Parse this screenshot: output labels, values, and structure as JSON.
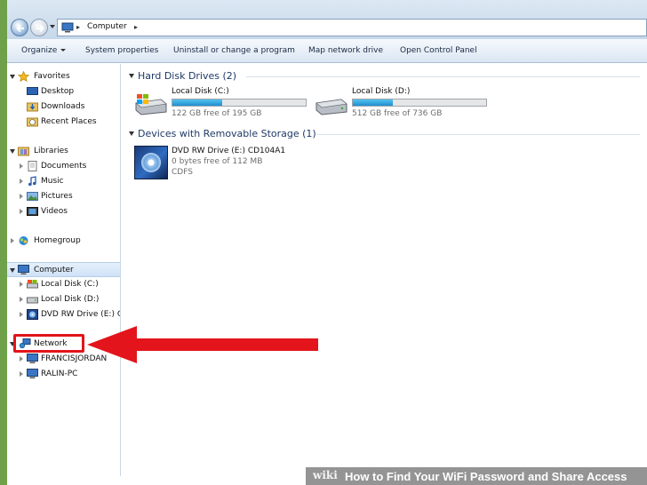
{
  "address_bar": {
    "path": [
      "Computer"
    ]
  },
  "toolbar": {
    "organize": "Organize",
    "system_properties": "System properties",
    "uninstall": "Uninstall or change a program",
    "map_drive": "Map network drive",
    "control_panel": "Open Control Panel"
  },
  "nav": {
    "favorites": {
      "label": "Favorites",
      "items": [
        "Desktop",
        "Downloads",
        "Recent Places"
      ]
    },
    "libraries": {
      "label": "Libraries",
      "items": [
        "Documents",
        "Music",
        "Pictures",
        "Videos"
      ]
    },
    "homegroup": {
      "label": "Homegroup"
    },
    "computer": {
      "label": "Computer",
      "items": [
        "Local Disk (C:)",
        "Local Disk (D:)",
        "DVD RW Drive (E:) C"
      ]
    },
    "network": {
      "label": "Network",
      "items": [
        "FRANCISJORDAN",
        "RALIN-PC"
      ]
    }
  },
  "content": {
    "hard_disk_group": {
      "title": "Hard Disk Drives (2)",
      "drives": [
        {
          "name": "Local Disk (C:)",
          "free_text": "122 GB free of 195 GB",
          "used_fraction": 0.37
        },
        {
          "name": "Local Disk (D:)",
          "free_text": "512 GB free of 736 GB",
          "used_fraction": 0.3
        }
      ]
    },
    "removable_group": {
      "title": "Devices with Removable Storage (1)",
      "device": {
        "name": "DVD RW Drive (E:) CD104A1",
        "free_text": "0 bytes free of 112 MB",
        "filesystem": "CDFS"
      }
    }
  },
  "annotation": {
    "color": "#e3141b"
  },
  "footer": {
    "brand": "wiki",
    "title": "How to Find Your WiFi Password and Share Access"
  }
}
